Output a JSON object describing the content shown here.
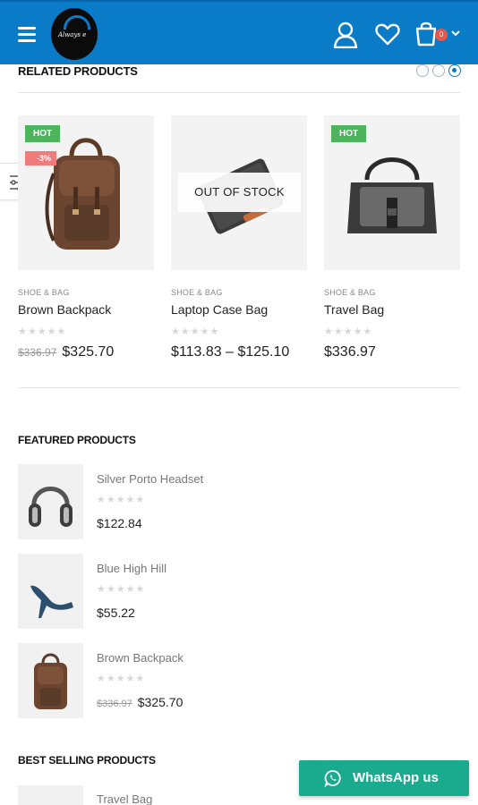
{
  "header": {
    "logo_text": "Always e",
    "cart_count": "0",
    "brand_color": "#0a7bc7"
  },
  "related": {
    "title": "RELATED PRODUCTS",
    "carousel_dots": 3,
    "active_dot": 3,
    "products": [
      {
        "badge_hot": "HOT",
        "badge_sale": "-3%",
        "category": "SHOE & BAG",
        "name": "Brown Backpack",
        "old_price": "$336.97",
        "price": "$325.70",
        "rating": 0
      },
      {
        "overlay": "OUT OF STOCK",
        "category": "SHOE & BAG",
        "name": "Laptop Case Bag",
        "price": "$113.83 – $125.10",
        "rating": 0
      },
      {
        "badge_hot": "HOT",
        "category": "SHOE & BAG",
        "name": "Travel Bag",
        "price": "$336.97",
        "rating": 0
      }
    ]
  },
  "featured": {
    "title": "FEATURED PRODUCTS",
    "items": [
      {
        "name": "Silver Porto Headset",
        "price": "$122.84",
        "rating": 0
      },
      {
        "name": "Blue High Hill",
        "price": "$55.22",
        "rating": 0
      },
      {
        "name": "Brown Backpack",
        "old_price": "$336.97",
        "price": "$325.70",
        "rating": 0
      }
    ]
  },
  "best_selling": {
    "title": "BEST SELLING PRODUCTS",
    "items": [
      {
        "name": "Travel Bag"
      }
    ]
  },
  "whatsapp": {
    "label": "WhatsApp us",
    "color": "#1aaa8e"
  },
  "rating_glyphs": "★★★★★"
}
